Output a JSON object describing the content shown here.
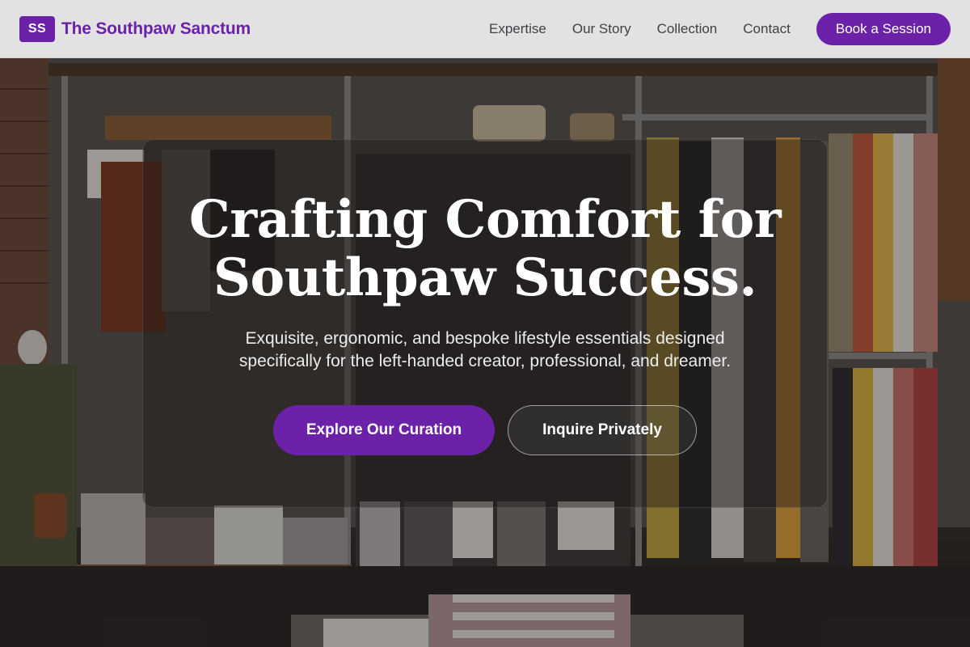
{
  "brand": {
    "mark": "SS",
    "name": "The Southpaw Sanctum",
    "color": "#6b21a8"
  },
  "nav": {
    "links": [
      "Expertise",
      "Our Story",
      "Collection",
      "Contact"
    ],
    "cta": "Book a Session"
  },
  "hero": {
    "title_line1": "Crafting Comfort for",
    "title_line2": "Southpaw Success.",
    "subtitle_line1": "Exquisite, ergonomic, and bespoke lifestyle essentials designed",
    "subtitle_line2": "specifically for the left-handed creator, professional, and dreamer.",
    "primary_cta": "Explore Our Curation",
    "secondary_cta": "Inquire Privately"
  },
  "background": {
    "description_icon": "clothing-store-photo"
  }
}
